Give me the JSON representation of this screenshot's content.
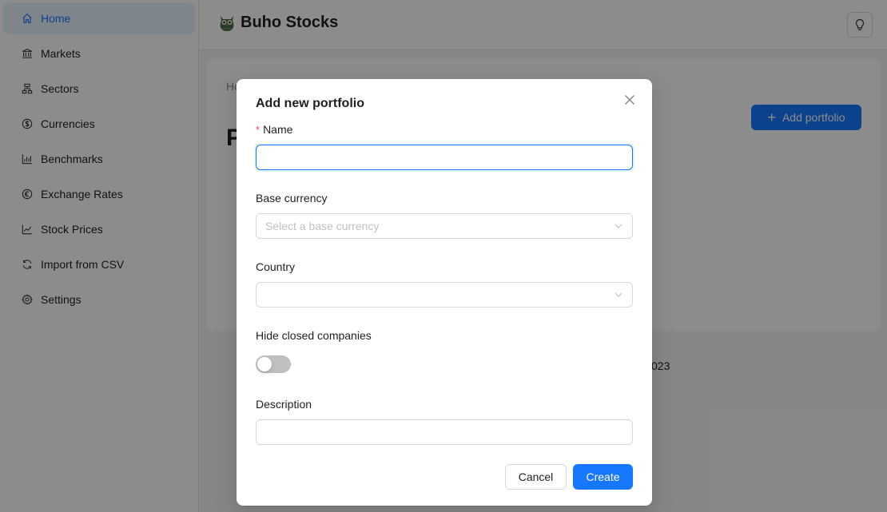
{
  "sidebar": {
    "items": [
      {
        "label": "Home",
        "icon": "home-icon",
        "active": true
      },
      {
        "label": "Markets",
        "icon": "bank-icon"
      },
      {
        "label": "Sectors",
        "icon": "cluster-icon"
      },
      {
        "label": "Currencies",
        "icon": "dollar-circle-icon"
      },
      {
        "label": "Benchmarks",
        "icon": "bar-chart-icon"
      },
      {
        "label": "Exchange Rates",
        "icon": "euro-circle-icon"
      },
      {
        "label": "Stock Prices",
        "icon": "line-chart-icon"
      },
      {
        "label": "Import from CSV",
        "icon": "sync-icon"
      },
      {
        "label": "Settings",
        "icon": "gear-icon"
      }
    ]
  },
  "header": {
    "brand": "Buho Stocks",
    "logo_icon": "owl-icon",
    "theme_button_icon": "bulb-icon"
  },
  "page": {
    "breadcrumb": "Ho",
    "title": "P",
    "add_button_label": "Add portfolio",
    "footer_text": "023"
  },
  "modal": {
    "title": "Add new portfolio",
    "fields": {
      "name": {
        "label": "Name",
        "value": "",
        "required_mark": "*"
      },
      "base_currency": {
        "label": "Base currency",
        "placeholder": "Select a base currency"
      },
      "country": {
        "label": "Country",
        "placeholder": ""
      },
      "hide_closed": {
        "label": "Hide closed companies",
        "checked": false
      },
      "description": {
        "label": "Description",
        "value": ""
      }
    },
    "cancel_label": "Cancel",
    "create_label": "Create"
  },
  "colors": {
    "primary": "#1677ff",
    "active_bg": "#e6f4ff",
    "required": "#ff4d4f"
  }
}
